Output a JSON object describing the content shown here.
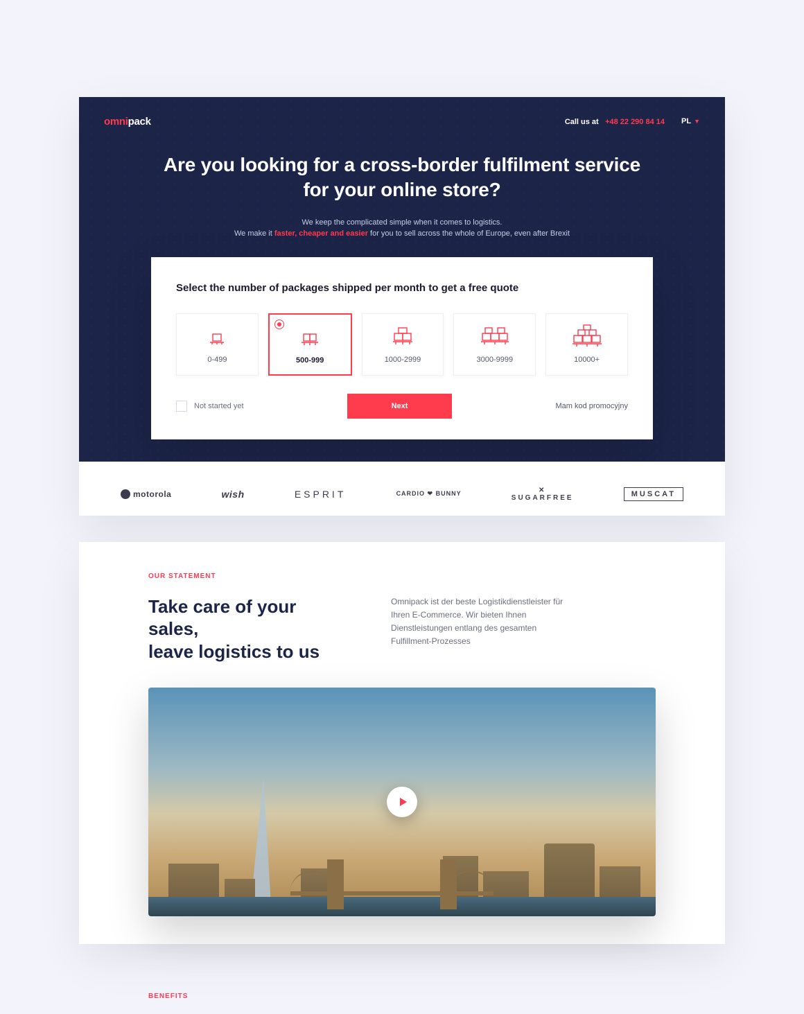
{
  "header": {
    "logo_pre": "omni",
    "logo_post": "pack",
    "call_label": "Call us at",
    "phone": "+48 22 290 84 14",
    "lang": "PL"
  },
  "hero": {
    "headline_l1": "Are you looking for a cross-border fulfilment service",
    "headline_l2": "for your online store?",
    "sub1": "We keep the complicated simple when it comes to logistics.",
    "sub2_pre": "We make it ",
    "sub2_hi": "faster, cheaper and easier",
    "sub2_post": " for you to sell across the whole of Europe, even after Brexit"
  },
  "quote": {
    "title": "Select the number of packages shipped per month to get a free quote",
    "options": [
      "0-499",
      "500-999",
      "1000-2999",
      "3000-9999",
      "10000+"
    ],
    "selected_index": 1,
    "not_started": "Not started yet",
    "next": "Next",
    "promo": "Mam kod promocyjny"
  },
  "logos": {
    "motorola": "motorola",
    "wish": "wish",
    "esprit": "ESPRIT",
    "cardio": "CARDIO ❤ BUNNY",
    "sugarfree_top": "✕",
    "sugarfree": "SUGARFREE",
    "muscat": "MUSCAT"
  },
  "statement": {
    "eyebrow": "OUR STATEMENT",
    "heading_l1": "Take care of your sales,",
    "heading_l2": "leave logistics to us",
    "body": "Omnipack ist der beste Logistikdienstleister für Ihren E-Commerce. Wir bieten Ihnen Dienstleistungen entlang des gesamten Fulfillment-Prozesses"
  },
  "benefits": {
    "eyebrow": "BENEFITS"
  }
}
